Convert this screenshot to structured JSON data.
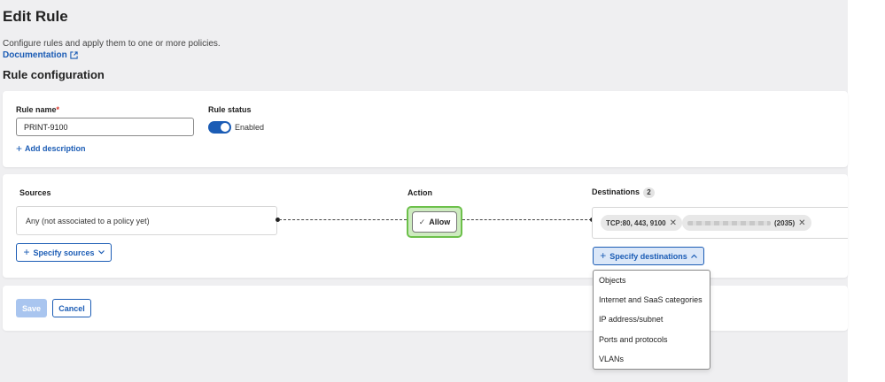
{
  "page": {
    "title": "Edit Rule",
    "description": "Configure rules and apply them to one or more policies.",
    "documentation_link": "Documentation",
    "section_title": "Rule configuration"
  },
  "rule": {
    "name_label": "Rule name",
    "required_mark": "*",
    "name_value": "PRINT-9100",
    "status_label": "Rule status",
    "status_value": "Enabled",
    "add_description": "Add description"
  },
  "sources": {
    "label": "Sources",
    "value": "Any (not associated to a policy yet)",
    "specify_button": "Specify sources"
  },
  "action": {
    "label": "Action",
    "value": "Allow"
  },
  "destinations": {
    "label": "Destinations",
    "count": "2",
    "chips": [
      {
        "label": "TCP:80, 443, 9100"
      },
      {
        "label": "(2035)"
      }
    ],
    "specify_button": "Specify destinations",
    "menu": [
      "Objects",
      "Internet and SaaS categories",
      "IP address/subnet",
      "Ports and protocols",
      "VLANs"
    ]
  },
  "footer": {
    "save": "Save",
    "cancel": "Cancel"
  },
  "icons": {
    "external": "external-link-icon",
    "plus": "plus-icon",
    "check": "check-icon",
    "close": "close-icon",
    "chevron_down": "chevron-down-icon",
    "chevron_up": "chevron-up-icon"
  },
  "colors": {
    "accent": "#1b5cb5",
    "action_highlight": "#6cc04a",
    "save_disabled": "#a9c5ef"
  }
}
